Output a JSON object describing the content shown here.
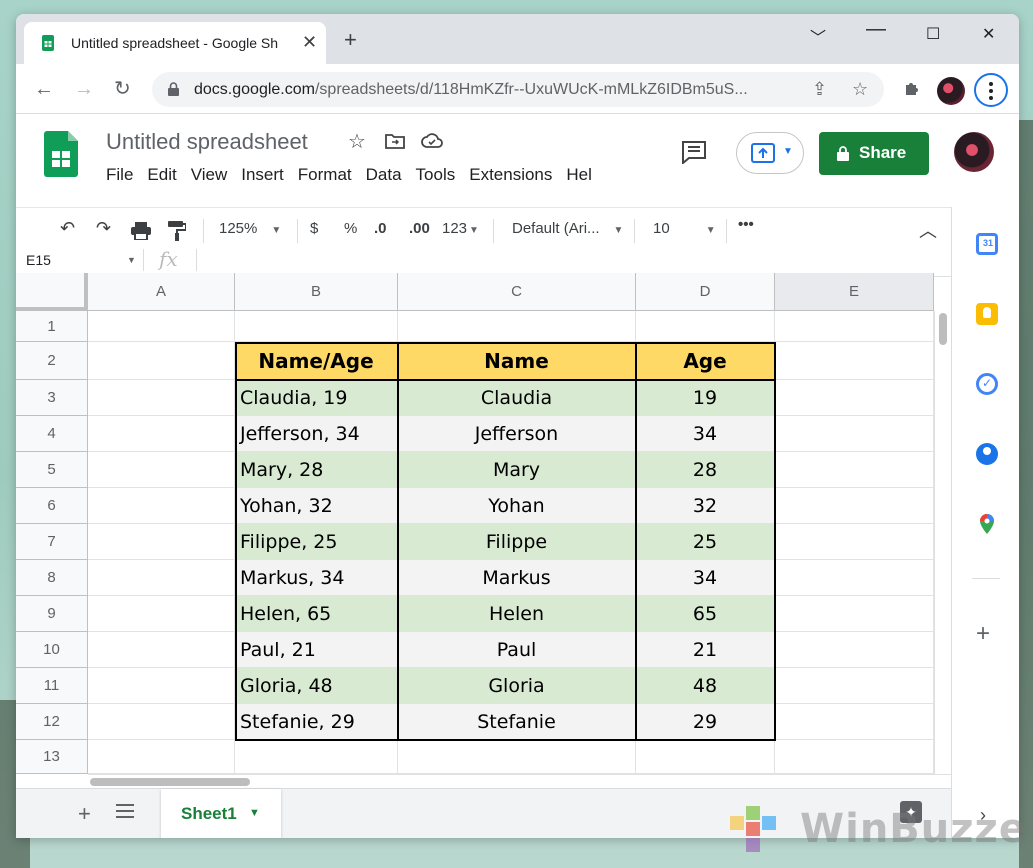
{
  "browser": {
    "tab_title": "Untitled spreadsheet - Google Sh",
    "url_host": "docs.google.com",
    "url_path": "/spreadsheets/d/118HmKZfr--UxuWUcK-mMLkZ6IDBm5uS..."
  },
  "app": {
    "doc_title": "Untitled spreadsheet",
    "menu": [
      "File",
      "Edit",
      "View",
      "Insert",
      "Format",
      "Data",
      "Tools",
      "Extensions",
      "Hel"
    ],
    "share_label": "Share"
  },
  "format_toolbar": {
    "zoom": "125%",
    "currency": "$",
    "percent": "%",
    "dec_decrease": ".0",
    "dec_increase": ".00",
    "more_formats": "123",
    "font": "Default (Ari...",
    "font_size": "10"
  },
  "formula_bar": {
    "cell_ref": "E15",
    "fx": "fx"
  },
  "columns": [
    "A",
    "B",
    "C",
    "D",
    "E"
  ],
  "rows": [
    "1",
    "2",
    "3",
    "4",
    "5",
    "6",
    "7",
    "8",
    "9",
    "10",
    "11",
    "12",
    "13"
  ],
  "table": {
    "headers": [
      "Name/Age",
      "Name",
      "Age"
    ],
    "data": [
      [
        "Claudia, 19",
        "Claudia",
        "19"
      ],
      [
        "Jefferson, 34",
        "Jefferson",
        "34"
      ],
      [
        "Mary, 28",
        "Mary",
        "28"
      ],
      [
        "Yohan, 32",
        "Yohan",
        "32"
      ],
      [
        "Filippe, 25",
        "Filippe",
        "25"
      ],
      [
        "Markus, 34",
        "Markus",
        "34"
      ],
      [
        "Helen, 65",
        "Helen",
        "65"
      ],
      [
        "Paul, 21",
        "Paul",
        "21"
      ],
      [
        "Gloria, 48",
        "Gloria",
        "48"
      ],
      [
        "Stefanie, 29",
        "Stefanie",
        "29"
      ]
    ]
  },
  "sheets": {
    "active": "Sheet1"
  },
  "watermark": "WinBuzzer",
  "colors": {
    "header_fill": "#ffd966",
    "band_green": "#d9ead3",
    "band_gray": "#f3f3f3",
    "accent_green": "#188038"
  }
}
